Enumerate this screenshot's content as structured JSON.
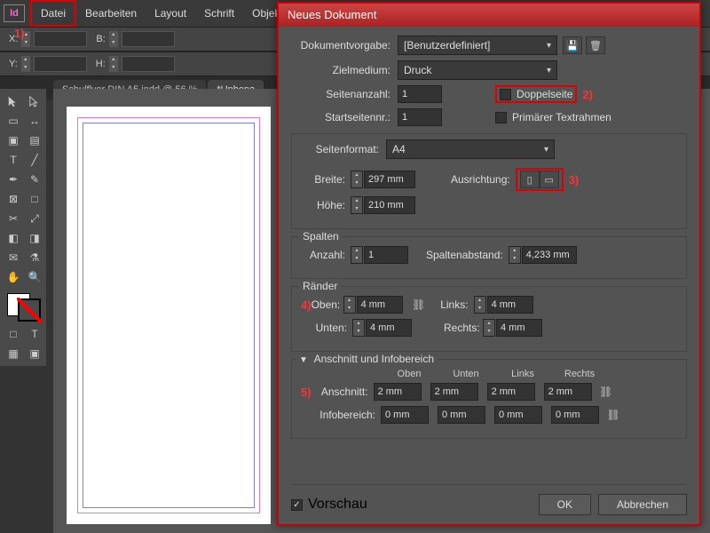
{
  "app": {
    "icon_text": "Id"
  },
  "menu": {
    "items": [
      "Datei",
      "Bearbeiten",
      "Layout",
      "Schrift",
      "Objekt"
    ]
  },
  "annotations": {
    "a1": "1)",
    "a2": "2)",
    "a3": "3)",
    "a4": "4)",
    "a5": "5)"
  },
  "controlbar": {
    "x_label": "X:",
    "y_label": "Y:",
    "w_label": "B:",
    "h_label": "H:"
  },
  "tabs": {
    "active": "Schulflyer DIN A5.indd @ 56 %",
    "inactive": "*Unbena"
  },
  "dialog": {
    "title": "Neues Dokument",
    "preset_label": "Dokumentvorgabe:",
    "preset_value": "[Benutzerdefiniert]",
    "intent_label": "Zielmedium:",
    "intent_value": "Druck",
    "pages_label": "Seitenanzahl:",
    "pages_value": "1",
    "facing_label": "Doppelseite",
    "startpage_label": "Startseitennr.:",
    "startpage_value": "1",
    "primarytext_label": "Primärer Textrahmen",
    "pageformat": {
      "legend": "Seitenformat:",
      "size_value": "A4",
      "width_label": "Breite:",
      "width_value": "297 mm",
      "height_label": "Höhe:",
      "height_value": "210 mm",
      "orient_label": "Ausrichtung:"
    },
    "columns": {
      "legend": "Spalten",
      "count_label": "Anzahl:",
      "count_value": "1",
      "gutter_label": "Spaltenabstand:",
      "gutter_value": "4,233 mm"
    },
    "margins": {
      "legend": "Ränder",
      "top_label": "Oben:",
      "top_value": "4 mm",
      "bottom_label": "Unten:",
      "bottom_value": "4 mm",
      "left_label": "Links:",
      "left_value": "4 mm",
      "right_label": "Rechts:",
      "right_value": "4 mm"
    },
    "bleed": {
      "legend": "Anschnitt und Infobereich",
      "hdr_top": "Oben",
      "hdr_bottom": "Unten",
      "hdr_left": "Links",
      "hdr_right": "Rechts",
      "bleed_label": "Anschnitt:",
      "bleed_top": "2 mm",
      "bleed_bottom": "2 mm",
      "bleed_left": "2 mm",
      "bleed_right": "2 mm",
      "slug_label": "Infobereich:",
      "slug_top": "0 mm",
      "slug_bottom": "0 mm",
      "slug_left": "0 mm",
      "slug_right": "0 mm"
    },
    "preview_label": "Vorschau",
    "ok_label": "OK",
    "cancel_label": "Abbrechen"
  }
}
